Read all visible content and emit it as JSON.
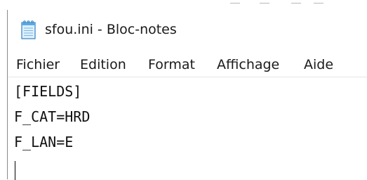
{
  "window": {
    "title": "sfou.ini - Bloc-notes"
  },
  "menubar": {
    "items": [
      "Fichier",
      "Edition",
      "Format",
      "Affichage",
      "Aide"
    ]
  },
  "editor": {
    "lines": [
      "[FIELDS]",
      "F_CAT=HRD",
      "F_LAN=E"
    ]
  },
  "icons": {
    "app": "notepad-icon"
  },
  "colors": {
    "background": "#ffffff",
    "text": "#1a1a1a",
    "window_border": "#8a8a8a",
    "icon_blue": "#5aa9e6"
  }
}
